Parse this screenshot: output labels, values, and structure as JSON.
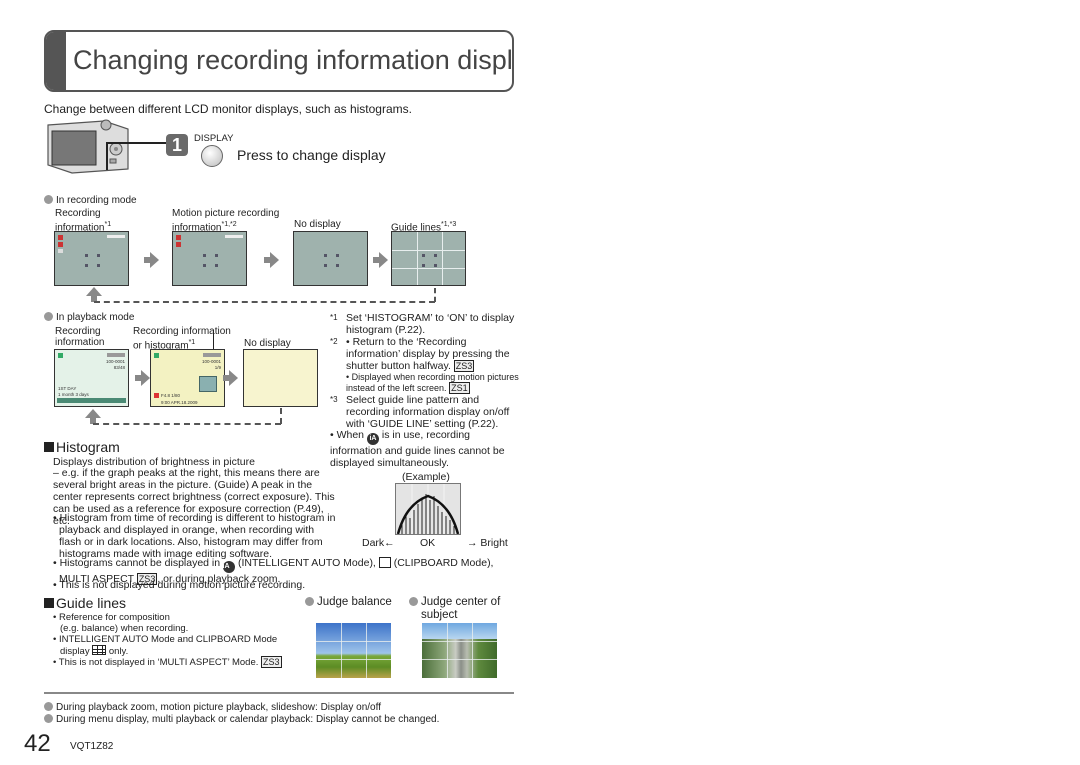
{
  "page": {
    "title": "Changing recording information display",
    "intro": "Change between different LCD monitor displays, such as histograms.",
    "step": {
      "number": "1",
      "button_label": "DISPLAY",
      "instruction": "Press to change display"
    },
    "recording_mode": {
      "heading": "In recording mode",
      "screens": [
        {
          "label_line1": "Recording",
          "label_line2": "information",
          "note": "*1"
        },
        {
          "label_line1": "Motion picture recording",
          "label_line2": "information",
          "note": "*1,*2"
        },
        {
          "label_line1": "",
          "label_line2": "No display",
          "note": ""
        },
        {
          "label_line1": "",
          "label_line2": "Guide lines",
          "note": "*1,*3"
        }
      ]
    },
    "playback_mode": {
      "heading": "In playback mode",
      "screens": [
        {
          "label_line1": "Recording",
          "label_line2": "information",
          "note": ""
        },
        {
          "label_line1": "Recording information",
          "label_line2": "or histogram",
          "note": "*1"
        },
        {
          "label_line1": "",
          "label_line2": "No display",
          "note": ""
        }
      ],
      "lcd_text": {
        "s1_counter": "100-0001",
        "s1_frames": "83/48",
        "s1_travel": "1ST DAY",
        "s1_age": "1 month 3 days",
        "s2_counter": "100-0001",
        "s2_frames": "1/9",
        "s2_exposure": "F4.8 1/80",
        "s2_datetime": "9:00 APR.18.2009"
      }
    },
    "footnotes": [
      {
        "mark": "*1",
        "text": "Set ‘HISTOGRAM’ to ‘ON’ to display histogram (P.22)."
      },
      {
        "mark": "*2",
        "text": "• Return to the ‘Recording information’ display by pressing the shutter button halfway.",
        "tag": "ZS3"
      },
      {
        "mark": "",
        "text": "• Displayed when recording motion pictures instead of the left screen.",
        "tag": "ZS1"
      },
      {
        "mark": "*3",
        "text": "Select guide line pattern and recording information display on/off with ‘GUIDE LINE’ setting (P.22)."
      }
    ],
    "ia_note": {
      "prefix": "• When",
      "icon": "iA",
      "suffix": "is in use, recording information and guide lines cannot be displayed simultaneously."
    },
    "histogram": {
      "heading": "Histogram",
      "desc": "Displays distribution of brightness in picture",
      "body": "– e.g. if the graph peaks at the right, this means there are several bright areas in the picture. (Guide) A peak in the center represents correct brightness (correct exposure). This can be used as a reference for exposure correction (P.49), etc.",
      "bullet1": "• Histogram from time of recording is different to histogram in playback and displayed in orange, when recording with flash or in dark locations. Also, histogram may differ from histograms made with image editing software.",
      "bullet2_a": "• Histograms cannot be displayed in",
      "bullet2_icon": "iA",
      "bullet2_b": "(INTELLIGENT AUTO Mode),",
      "bullet2_c": "(CLIPBOARD Mode),",
      "bullet2_d": "MULTI ASPECT",
      "bullet2_tag": "ZS3",
      "bullet2_e": ", or during playback zoom.",
      "bullet3": "• This is not displayed during motion picture recording.",
      "example": {
        "caption": "(Example)",
        "dark": "Dark←",
        "ok": "OK",
        "bright": "→ Bright"
      }
    },
    "guide_lines": {
      "heading": "Guide lines",
      "bullet1a": "• Reference for composition",
      "bullet1b": "(e.g. balance) when recording.",
      "bullet2a": "• INTELLIGENT AUTO Mode and CLIPBOARD Mode",
      "bullet2b": "display",
      "bullet2c": "only.",
      "bullet3": "• This is not displayed in ‘MULTI ASPECT’ Mode.",
      "bullet3_tag": "ZS3",
      "examples": [
        {
          "label_line1": "Judge balance",
          "label_line2": ""
        },
        {
          "label_line1": "Judge center of",
          "label_line2": "subject"
        }
      ]
    },
    "bottom_notes": [
      "During playback zoom, motion picture playback, slideshow: Display on/off",
      "During menu display, multi playback or calendar playback: Display cannot be changed."
    ],
    "footer": {
      "page_number": "42",
      "doc_code": "VQT1Z82"
    }
  }
}
